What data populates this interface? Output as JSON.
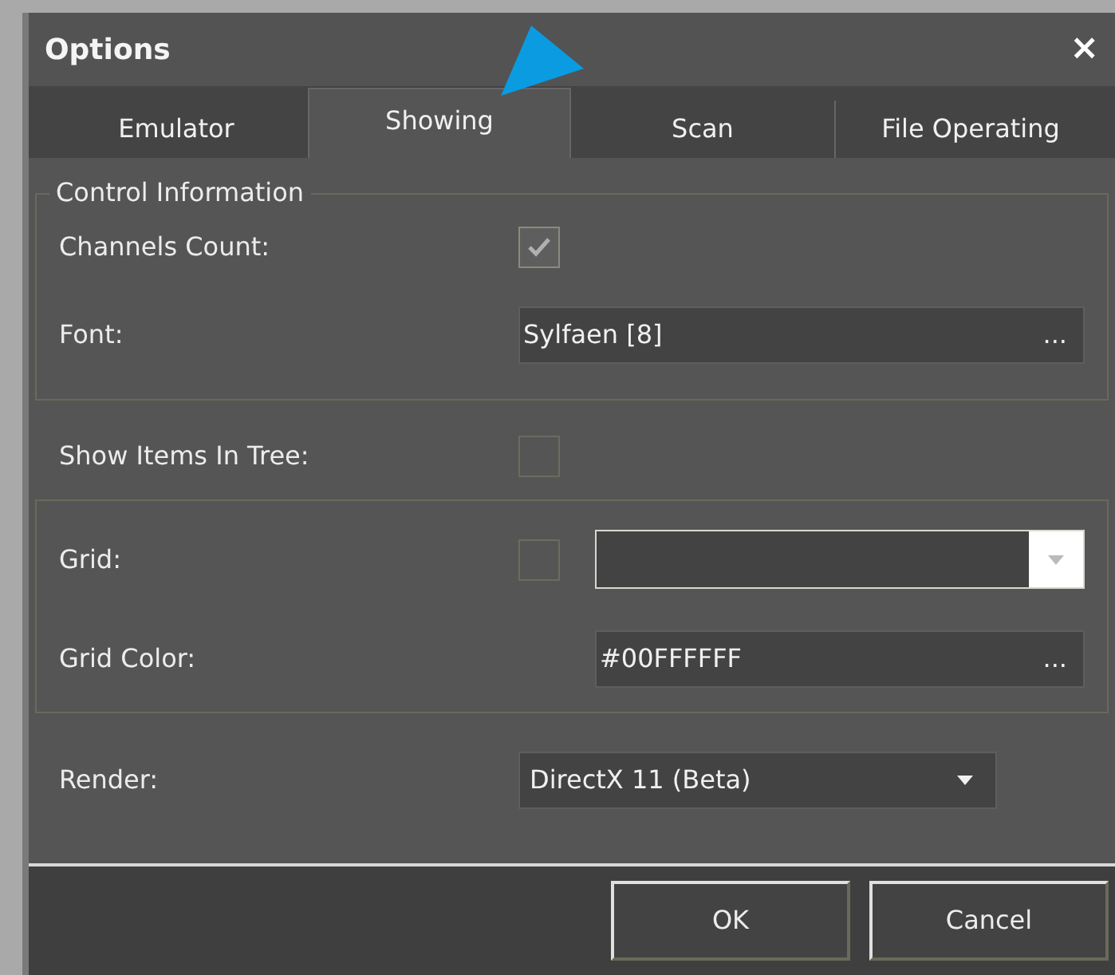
{
  "window": {
    "title": "Options",
    "close": "×"
  },
  "tabs": [
    {
      "label": "Emulator",
      "selected": false
    },
    {
      "label": "Showing",
      "selected": true
    },
    {
      "label": "Scan",
      "selected": false
    },
    {
      "label": "File Operating",
      "selected": false
    }
  ],
  "control_information": {
    "title": "Control Information",
    "channels_count": {
      "label": "Channels Count:",
      "checked": true
    },
    "font": {
      "label": "Font:",
      "value": "Sylfaen [8]",
      "button": "..."
    }
  },
  "show_items_in_tree": {
    "label": "Show Items In Tree:",
    "checked": false
  },
  "grid": {
    "label": "Grid:",
    "checked": false,
    "grid_color": {
      "label": "Grid Color:",
      "value": "#00FFFFFF",
      "button": "..."
    }
  },
  "render": {
    "label": "Render:",
    "value": "DirectX 11 (Beta)"
  },
  "buttons": [
    "OK",
    "Cancel"
  ]
}
